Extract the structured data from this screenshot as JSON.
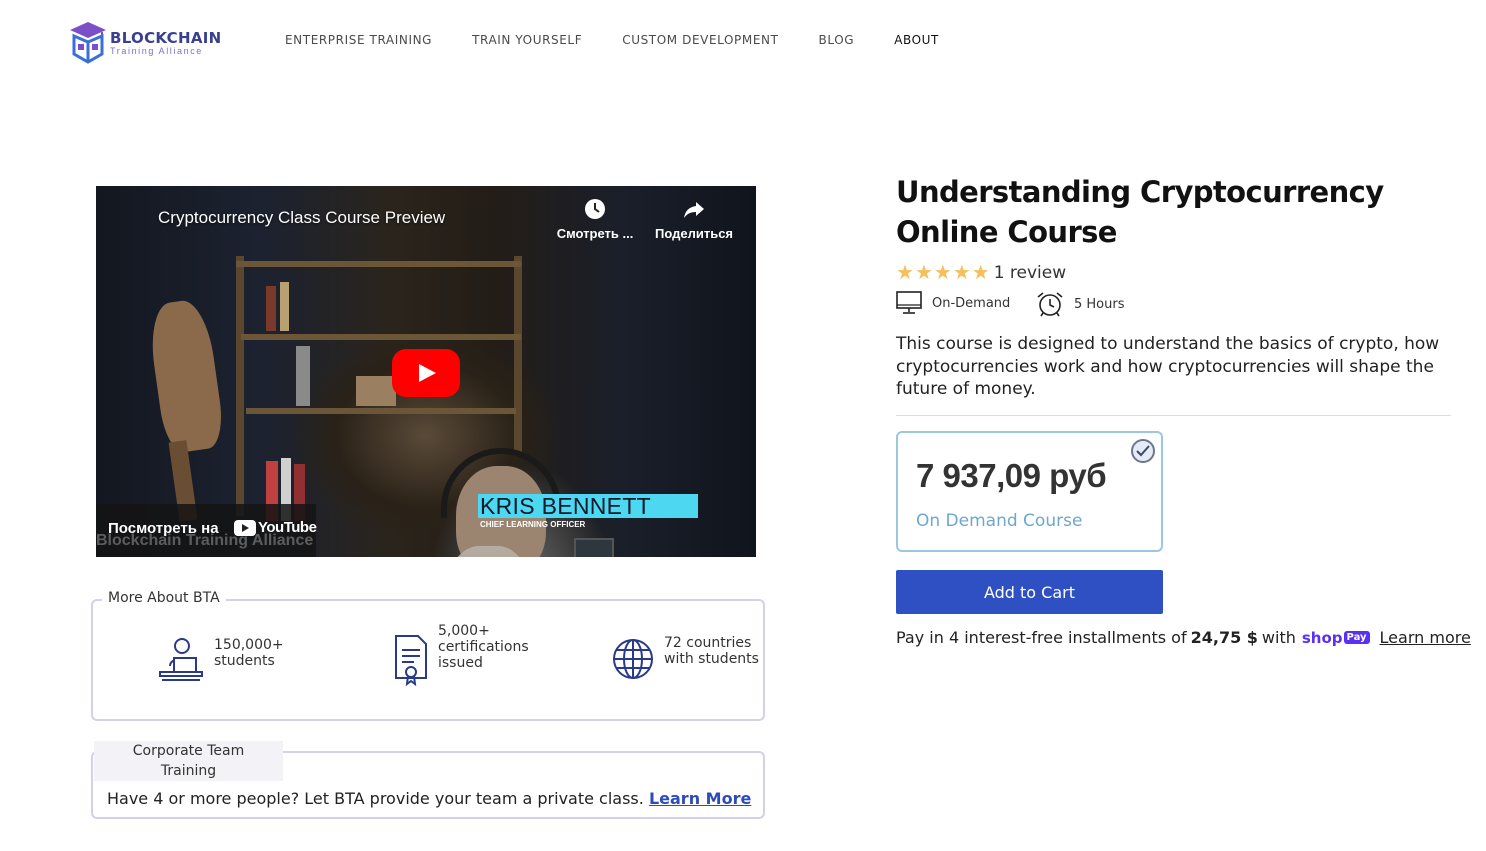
{
  "brand": {
    "name": "BLOCKCHAIN",
    "tagline": "Training Alliance",
    "colors": {
      "primary": "#3a3f8f",
      "accent": "#7b6fd0"
    }
  },
  "nav": {
    "items": [
      {
        "label": "ENTERPRISE TRAINING"
      },
      {
        "label": "TRAIN YOURSELF"
      },
      {
        "label": "CUSTOM DEVELOPMENT"
      },
      {
        "label": "BLOG"
      },
      {
        "label": "ABOUT"
      }
    ]
  },
  "video": {
    "title": "Cryptocurrency Class Course Preview",
    "watch_later_label": "Смотреть ...",
    "share_label": "Поделиться",
    "watch_on_label": "Посмотреть на",
    "youtube_label": "YouTube",
    "lower_third_name": "KRIS BENNETT",
    "lower_third_role": "CHIEF LEARNING OFFICER",
    "watermark": "Blockchain Training Alliance"
  },
  "more_about": {
    "legend": "More About BTA",
    "stats": [
      {
        "icon": "student-laptop-icon",
        "line1": "150,000+",
        "line2": "students",
        "line3": ""
      },
      {
        "icon": "certificate-icon",
        "line1": "5,000+",
        "line2": "certifications",
        "line3": "issued"
      },
      {
        "icon": "globe-icon",
        "line1": "72 countries",
        "line2": "with students",
        "line3": ""
      }
    ]
  },
  "corporate": {
    "legend_line1": "Corporate Team",
    "legend_line2": "Training",
    "text": "Have 4 or more people? Let BTA provide your team a private class.",
    "link": "Learn More"
  },
  "course": {
    "title_line1": "Understanding Cryptocurrency",
    "title_line2": "Online Course",
    "rating_stars": 5,
    "review_count": "1 review",
    "format": "On-Demand",
    "duration": "5 Hours",
    "description": "This course is designed to understand the basics of crypto, how cryptocurrencies work and how cryptocurrencies will shape the future of money.",
    "price": "7 937,09 руб",
    "price_type": "On Demand Course",
    "add_to_cart": "Add to Cart",
    "installments_prefix": "Pay in 4 interest-free installments of",
    "installment_amount": "24,75 $",
    "installments_with": "with",
    "shop_label": "shop",
    "pay_label": "Pay",
    "learn_more": "Learn more",
    "colors": {
      "button": "#2f50c2",
      "star": "#f5c05c",
      "card_border": "#9cc8df"
    }
  }
}
